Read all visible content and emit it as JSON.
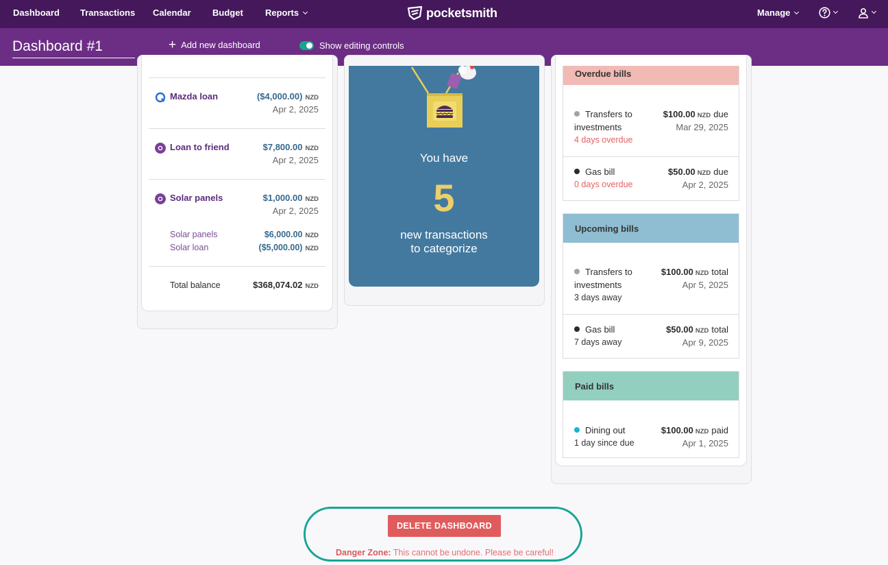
{
  "nav": {
    "items": [
      "Dashboard",
      "Transactions",
      "Calendar",
      "Budget"
    ],
    "reports": "Reports",
    "logo_text": "pocketsmith",
    "manage": "Manage"
  },
  "toolbar": {
    "dashboard_title": "Dashboard #1",
    "add_dashboard": "Add new dashboard",
    "show_editing": "Show editing controls",
    "editing_enabled": true
  },
  "accounts": {
    "items": [
      {
        "name": "Mazda loan",
        "value": "($4,000.00)",
        "currency": "NZD",
        "date": "Apr 2, 2025",
        "icon": "loan-refresh-icon"
      },
      {
        "name": "Loan to friend",
        "value": "$7,800.00",
        "currency": "NZD",
        "date": "Apr 2, 2025",
        "icon": "account-circle-icon"
      },
      {
        "name": "Solar panels",
        "value": "$1,000.00",
        "currency": "NZD",
        "date": "Apr 2, 2025",
        "icon": "account-circle-icon"
      }
    ],
    "sub_items": [
      {
        "name": "Solar panels",
        "value": "$6,000.00",
        "currency": "NZD"
      },
      {
        "name": "Solar loan",
        "value": "($5,000.00)",
        "currency": "NZD"
      }
    ],
    "total_label": "Total balance",
    "total_value": "$368,074.02",
    "total_currency": "NZD"
  },
  "uncategorized": {
    "line1": "You have",
    "count": "5",
    "line2": "new transactions",
    "line3": "to categorize"
  },
  "bills": {
    "overdue": {
      "title": "Overdue bills",
      "items": [
        {
          "name1": "Transfers to",
          "name2": "investments",
          "amount": "$100.00",
          "currency": "NZD",
          "suffix": "due",
          "date": "Mar 29, 2025",
          "status": "4 days overdue",
          "dot_color": "#a3a3a3"
        },
        {
          "name1": "Gas bill",
          "amount": "$50.00",
          "currency": "NZD",
          "suffix": "due",
          "date": "Apr 2, 2025",
          "status": "0 days overdue",
          "dot_color": "#2b2b2b"
        }
      ]
    },
    "upcoming": {
      "title": "Upcoming bills",
      "items": [
        {
          "name1": "Transfers to",
          "name2": "investments",
          "amount": "$100.00",
          "currency": "NZD",
          "suffix": "total",
          "date": "Apr 5, 2025",
          "status": "3 days away",
          "dot_color": "#a3a3a3"
        },
        {
          "name1": "Gas bill",
          "amount": "$50.00",
          "currency": "NZD",
          "suffix": "total",
          "date": "Apr 9, 2025",
          "status": "7 days away",
          "dot_color": "#2b2b2b"
        }
      ]
    },
    "paid": {
      "title": "Paid bills",
      "items": [
        {
          "name1": "Dining out",
          "amount": "$100.00",
          "currency": "NZD",
          "suffix": "paid",
          "date": "Apr 1, 2025",
          "status": "1 day since due",
          "dot_color": "#19b4d2"
        }
      ]
    }
  },
  "danger": {
    "button": "DELETE DASHBOARD",
    "label": "Danger Zone:",
    "text": "This cannot be undone. Please be careful!"
  },
  "colors": {
    "nav_bg": "#44185a",
    "subbar_bg": "#6c2d85",
    "overdue_header": "#f2bab4",
    "upcoming_header": "#8fbdd1",
    "paid_header": "#92cfbf",
    "uncategorized_card": "#43799f",
    "delete_button": "#e05c5c",
    "highlight_ring": "#17a594"
  }
}
